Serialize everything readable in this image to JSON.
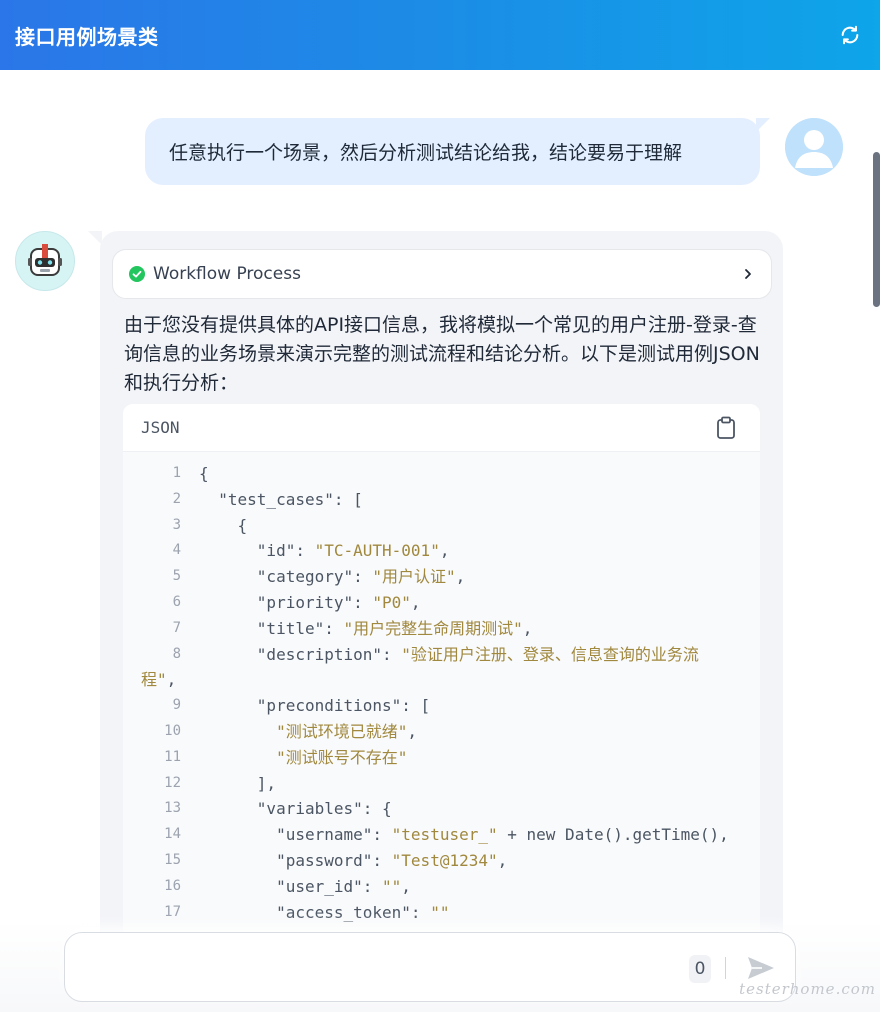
{
  "header": {
    "title": "接口用例场景类",
    "refresh_icon": "refresh-icon"
  },
  "user_message": {
    "text": "任意执行一个场景，然后分析测试结论给我，结论要易于理解",
    "avatar_icon": "user-avatar-icon"
  },
  "bot_message": {
    "avatar_icon": "robot-avatar-icon",
    "workflow": {
      "label": "Workflow Process",
      "status_icon": "check-circle-icon",
      "status_color": "#22c55e"
    },
    "paragraph": "由于您没有提供具体的API接口信息，我将模拟一个常见的用户注册-登录-查询信息的业务场景来演示完整的测试流程和结论分析。以下是测试用例JSON和执行分析：",
    "code": {
      "language": "JSON",
      "copy_icon": "clipboard-icon",
      "lines": [
        {
          "n": "1",
          "text": "{"
        },
        {
          "n": "2",
          "text": "  \"test_cases\": ["
        },
        {
          "n": "3",
          "text": "    {"
        },
        {
          "n": "4",
          "key": "      \"id\": ",
          "str": "\"TC-AUTH-001\"",
          "tail": ","
        },
        {
          "n": "5",
          "key": "      \"category\": ",
          "str": "\"用户认证\"",
          "tail": ","
        },
        {
          "n": "6",
          "key": "      \"priority\": ",
          "str": "\"P0\"",
          "tail": ","
        },
        {
          "n": "7",
          "key": "      \"title\": ",
          "str": "\"用户完整生命周期测试\"",
          "tail": ","
        },
        {
          "n": "8",
          "key": "      \"description\": ",
          "str": "\"验证用户注册、登录、信息查询的业务流",
          "wrap": "程\"",
          "wrap_tail": ","
        },
        {
          "n": "9",
          "text": "      \"preconditions\": ["
        },
        {
          "n": "10",
          "key": "        ",
          "str": "\"测试环境已就绪\"",
          "tail": ","
        },
        {
          "n": "11",
          "key": "        ",
          "str": "\"测试账号不存在\"",
          "tail": ""
        },
        {
          "n": "12",
          "text": "      ],"
        },
        {
          "n": "13",
          "text": "      \"variables\": {"
        },
        {
          "n": "14",
          "key": "        \"username\": ",
          "str": "\"testuser_\"",
          "tail": " + new Date().getTime(),"
        },
        {
          "n": "15",
          "key": "        \"password\": ",
          "str": "\"Test@1234\"",
          "tail": ","
        },
        {
          "n": "16",
          "key": "        \"user_id\": ",
          "str": "\"\"",
          "tail": ","
        },
        {
          "n": "17",
          "key": "        \"access_token\": ",
          "str": "\"\"",
          "tail": ""
        }
      ]
    }
  },
  "composer": {
    "placeholder": "",
    "char_count": "0",
    "send_icon": "send-icon"
  },
  "watermark": "testerhome.com"
}
